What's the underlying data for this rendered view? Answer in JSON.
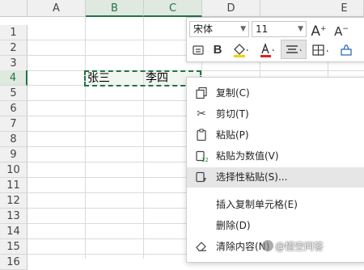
{
  "columns": [
    "A",
    "B",
    "C",
    "D",
    "E"
  ],
  "rows": [
    "1",
    "2",
    "3",
    "4",
    "5",
    "6",
    "7",
    "8",
    "9",
    "10",
    "11",
    "12",
    "13",
    "14",
    "15",
    "16"
  ],
  "cells": {
    "b4": "张三",
    "c4": "李四"
  },
  "toolbar": {
    "font_name": "宋体",
    "font_size": "11",
    "grow_font": "A",
    "shrink_font": "A",
    "bold": "B"
  },
  "context_menu": [
    {
      "label": "复制(C)",
      "icon": "copy-icon"
    },
    {
      "label": "剪切(T)",
      "icon": "scissors-icon"
    },
    {
      "label": "粘贴(P)",
      "icon": "paste-icon"
    },
    {
      "label": "粘贴为数值(V)",
      "icon": "paste-values-icon"
    },
    {
      "label": "选择性粘贴(S)...",
      "icon": "paste-special-icon"
    },
    {
      "label": "插入复制单元格(E)",
      "icon": ""
    },
    {
      "label": "删除(D)",
      "icon": ""
    },
    {
      "label": "清除内容(N)",
      "icon": "eraser-icon"
    }
  ],
  "watermark": "@悟空问答",
  "colors": {
    "accent": "#217346",
    "highlight": "#e6e6e6",
    "font_color_red": "#e02020",
    "fill_yellow": "#f5d000"
  }
}
